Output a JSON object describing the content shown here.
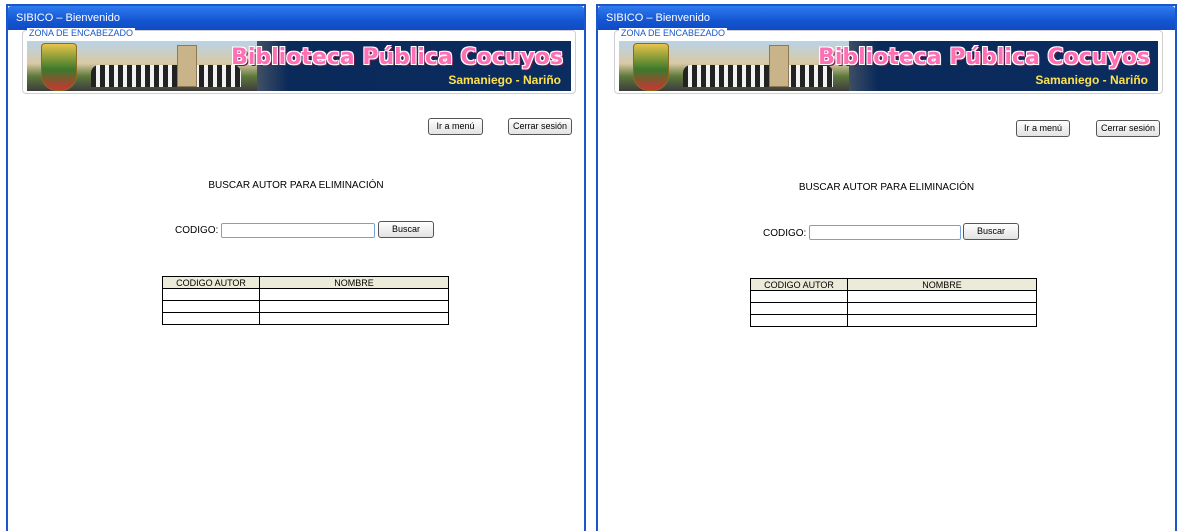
{
  "windows": [
    {
      "title": "SIBICO – Bienvenido",
      "zone_label": "ZONA DE ENCABEZADO",
      "banner": {
        "title": "Biblioteca Pública Cocuyos",
        "subtitle": "Samaniego - Nariño"
      },
      "menu_button": "Ir a menú",
      "logout_button": "Cerrar sesión",
      "heading": "BUSCAR AUTOR PARA ELIMINACIÓN",
      "code_label": "CODIGO:",
      "code_value": "",
      "search_button": "Buscar",
      "table": {
        "headers": [
          "CODIGO AUTOR",
          "NOMBRE"
        ],
        "rows": [
          [
            "",
            ""
          ],
          [
            "",
            ""
          ],
          [
            "",
            ""
          ]
        ]
      }
    },
    {
      "title": "SIBICO – Bienvenido",
      "zone_label": "ZONA DE ENCABEZADO",
      "banner": {
        "title": "Biblioteca Pública Cocuyos",
        "subtitle": "Samaniego - Nariño"
      },
      "menu_button": "Ir a menú",
      "logout_button": "Cerrar sesión",
      "heading": "BUSCAR AUTOR PARA ELIMINACIÓN",
      "code_label": "CODIGO:",
      "code_value": "",
      "search_button": "Buscar",
      "table": {
        "headers": [
          "CODIGO AUTOR",
          "NOMBRE"
        ],
        "rows": [
          [
            "",
            ""
          ],
          [
            "",
            ""
          ],
          [
            "",
            ""
          ]
        ]
      }
    }
  ]
}
